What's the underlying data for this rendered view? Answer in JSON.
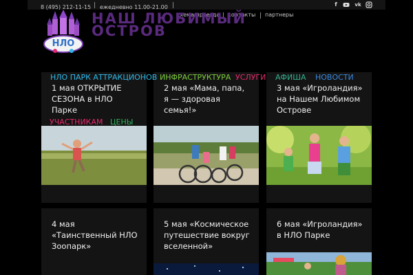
{
  "topbar": {
    "phone": "8 (495) 212-11-15",
    "hours": "ежедневно 11.00-21.00",
    "links": [
      "схема проезда",
      "контакты",
      "партнеры"
    ],
    "social": [
      "facebook-icon",
      "youtube-icon",
      "vk-icon",
      "instagram-icon"
    ]
  },
  "site_title": "Наш любимый остров",
  "logo_text": "НЛО",
  "nav": {
    "items": [
      {
        "label": "НЛО ПАРК АТТРАКЦИОНОВ",
        "color": "#2fb8e8"
      },
      {
        "label": "ИНФРАСТРУКТУРА",
        "color": "#7ccd3b"
      },
      {
        "label": "УСЛУГИ",
        "color": "#e8296e"
      },
      {
        "label": "АФИША",
        "color": "#32b38f"
      },
      {
        "label": "НОВОСТИ",
        "color": "#3a88df"
      },
      {
        "label": "УЧАСТНИКАМ",
        "color": "#e8296e"
      },
      {
        "label": "ЦЕНЫ",
        "color": "#32b35f"
      }
    ]
  },
  "cards": [
    {
      "title": "1 мая ОТКРЫТИЕ СЕЗОНА в НЛО Парке"
    },
    {
      "title": "2 мая «Мама, папа, я — здоровая семья!»"
    },
    {
      "title": "3 мая «Игроландия» на Нашем Любимом Острове"
    },
    {
      "title": "4 мая «Таинственный НЛО Зоопарк»"
    },
    {
      "title": "5 мая «Космическое путешествие вокруг вселенной»"
    },
    {
      "title": "6 мая «Игроландия» в НЛО Парке"
    }
  ]
}
